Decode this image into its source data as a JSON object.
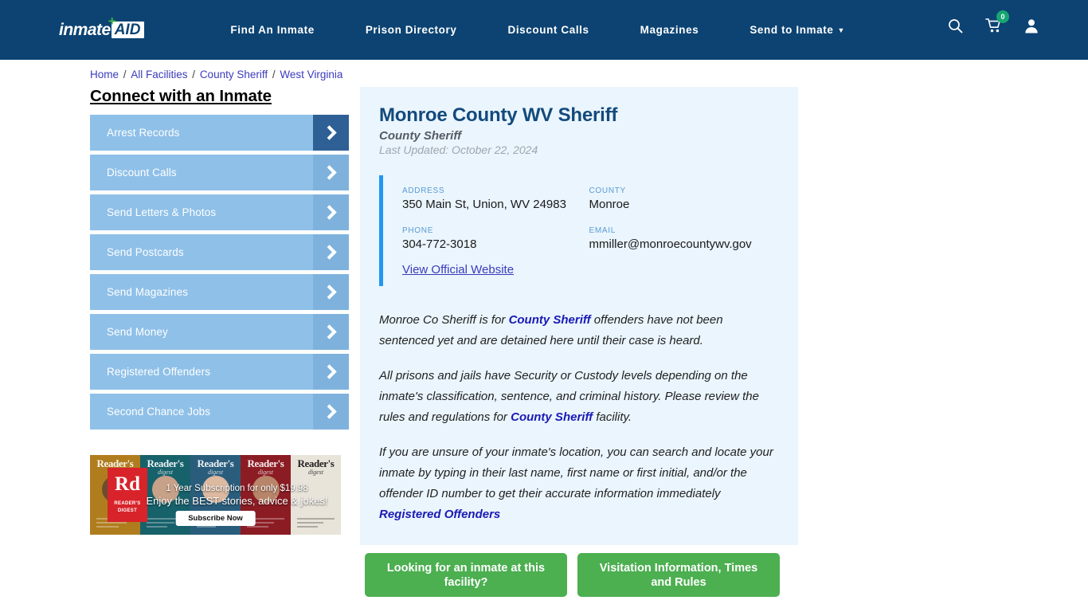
{
  "header": {
    "logo": {
      "word": "inmate",
      "box": "AID",
      "plus": "+"
    },
    "nav": [
      {
        "label": "Find An Inmate",
        "dropdown": false
      },
      {
        "label": "Prison Directory",
        "dropdown": false
      },
      {
        "label": "Discount Calls",
        "dropdown": false
      },
      {
        "label": "Magazines",
        "dropdown": false
      },
      {
        "label": "Send to Inmate",
        "dropdown": true
      }
    ],
    "icons": {
      "search": "search-icon",
      "cart": "cart-icon",
      "cart_count": "0",
      "account": "user-icon"
    },
    "colors": {
      "bar": "#0c4372",
      "badge": "#17a673"
    }
  },
  "breadcrumb": {
    "items": [
      "Home",
      "All Facilities",
      "County Sheriff",
      "West Virginia"
    ],
    "separator": "/"
  },
  "sidebar": {
    "title": "Connect with an Inmate",
    "items": [
      {
        "label": "Arrest Records",
        "active": true
      },
      {
        "label": "Discount Calls",
        "active": false
      },
      {
        "label": "Send Letters & Photos",
        "active": false
      },
      {
        "label": "Send Postcards",
        "active": false
      },
      {
        "label": "Send Magazines",
        "active": false
      },
      {
        "label": "Send Money",
        "active": false
      },
      {
        "label": "Registered Offenders",
        "active": false
      },
      {
        "label": "Second Chance Jobs",
        "active": false
      }
    ]
  },
  "ad": {
    "brand_big": "Rd",
    "brand_line1": "READER'S",
    "brand_line2": "DIGEST",
    "line1": "1 Year Subscription for only $19.98",
    "line2": "Enjoy the BEST stories, advice & jokes!",
    "button": "Subscribe Now",
    "covers": [
      {
        "title": "Reader's",
        "sub": "digest"
      },
      {
        "title": "Reader's",
        "sub": "digest"
      },
      {
        "title": "Reader's",
        "sub": "digest"
      },
      {
        "title": "Reader's",
        "sub": "digest"
      },
      {
        "title": "Reader's",
        "sub": "digest"
      }
    ]
  },
  "facility": {
    "name": "Monroe County WV Sheriff",
    "type": "County Sheriff",
    "last_updated": "Last Updated: October 22, 2024",
    "info": [
      {
        "label": "ADDRESS",
        "value": "350 Main St, Union, WV 24983"
      },
      {
        "label": "COUNTY",
        "value": "Monroe"
      },
      {
        "label": "PHONE",
        "value": "304-772-3018"
      },
      {
        "label": "EMAIL",
        "value": "mmiller@monroecountywv.gov"
      }
    ],
    "website_link": "View Official Website",
    "description": {
      "p1_a": "Monroe Co Sheriff is for ",
      "p1_link": "County Sheriff",
      "p1_b": " offenders have not been sentenced yet and are detained here until their case is heard.",
      "p2_a": "All prisons and jails have Security or Custody levels depending on the inmate's classification, sentence, and criminal history. Please review the rules and regulations for ",
      "p2_link": "County Sheriff",
      "p2_b": " facility.",
      "p3_a": "If you are unsure of your inmate's location, you can search and locate your inmate by typing in their last name, first name or first initial, and/or the offender ID number to get their accurate information immediately ",
      "p3_link": "Registered Offenders"
    }
  },
  "cta": [
    {
      "label": "Looking for an inmate at this facility?"
    },
    {
      "label": "Visitation Information, Times and Rules"
    }
  ],
  "colors": {
    "header_blue": "#0c4372",
    "card_bg": "#eaf5fd",
    "accent_bar": "#2196f3",
    "sidebar_item": "#8fc0e8",
    "sidebar_arrow": "#7eb2dd",
    "sidebar_arrow_active": "#2f6095",
    "cta_green": "#4caf50",
    "link_blue": "#3b3bbb",
    "title_blue": "#134a7c"
  }
}
